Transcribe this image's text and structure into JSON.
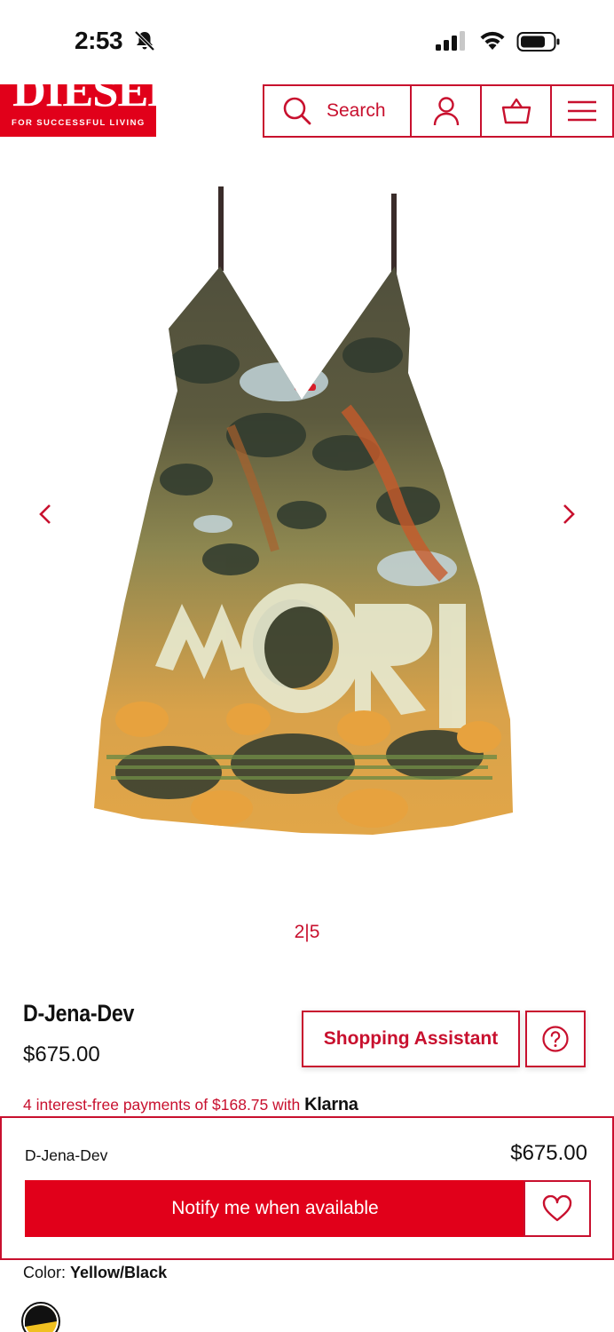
{
  "status_bar": {
    "time": "2:53"
  },
  "header": {
    "logo_text": "DIESEL",
    "logo_tagline": "FOR SUCCESSFUL LIVING",
    "search_label": "Search"
  },
  "gallery": {
    "counter": "2|5"
  },
  "product": {
    "name": "D-Jena-Dev",
    "price": "$675.00",
    "assistant_label": "Shopping Assistant",
    "klarna_text": "4 interest-free payments of $168.75 with",
    "klarna_brand": "Klarna"
  },
  "buy_panel": {
    "name": "D-Jena-Dev",
    "price": "$675.00",
    "notify_label": "Notify me when available"
  },
  "color": {
    "label": "Color:",
    "value": "Yellow/Black"
  },
  "colors": {
    "brand": "#e1001a",
    "accent_outline": "#c8102e"
  }
}
